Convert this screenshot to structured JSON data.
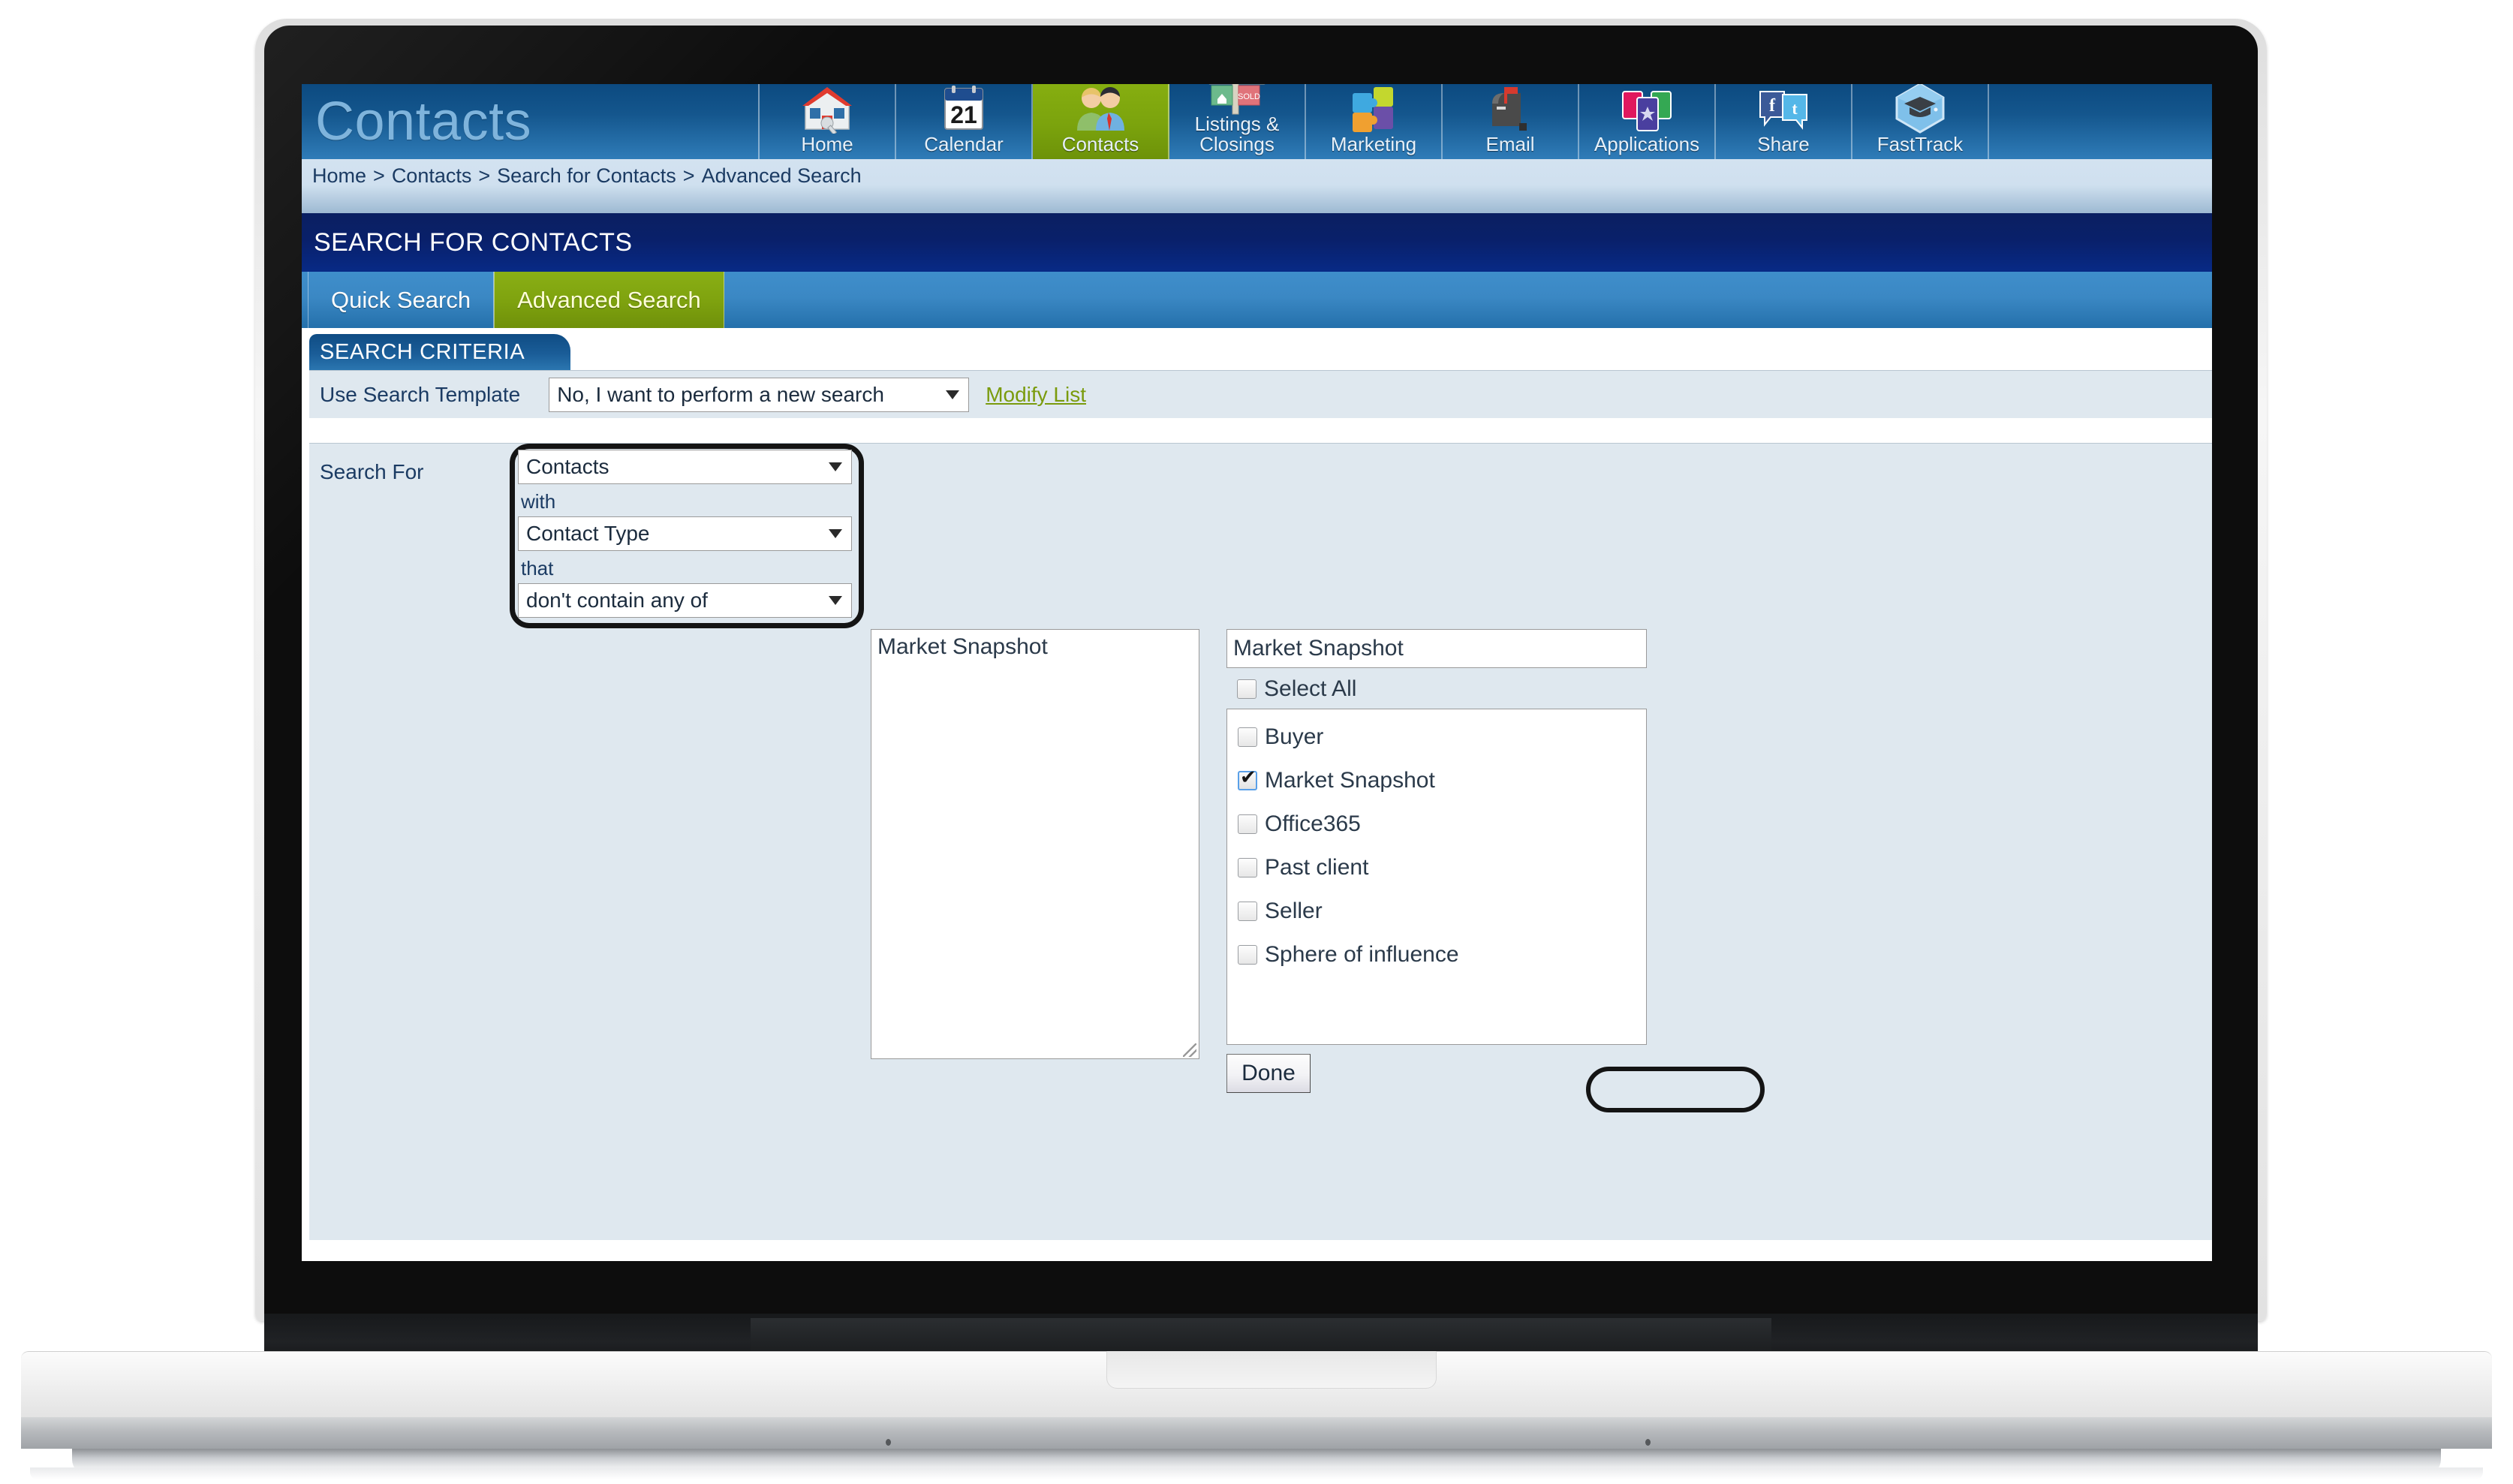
{
  "header": {
    "brand": "Contacts",
    "nav": [
      {
        "label": "Home",
        "icon": "house-icon",
        "active": false
      },
      {
        "label": "Calendar",
        "icon": "calendar-icon",
        "active": false
      },
      {
        "label": "Contacts",
        "icon": "people-icon",
        "active": true
      },
      {
        "label": "Listings &\nClosings",
        "icon": "sold-sign-icon",
        "active": false
      },
      {
        "label": "Marketing",
        "icon": "puzzle-icon",
        "active": false
      },
      {
        "label": "Email",
        "icon": "mailbox-icon",
        "active": false
      },
      {
        "label": "Applications",
        "icon": "apps-icon",
        "active": false
      },
      {
        "label": "Share",
        "icon": "social-icon",
        "active": false
      },
      {
        "label": "FastTrack",
        "icon": "graduation-hex-icon",
        "active": false
      }
    ]
  },
  "breadcrumb": {
    "items": [
      "Home",
      "Contacts",
      "Search for Contacts",
      "Advanced Search"
    ],
    "separator": ">"
  },
  "page_title": "SEARCH FOR CONTACTS",
  "tabs": [
    {
      "label": "Quick Search",
      "active": false
    },
    {
      "label": "Advanced Search",
      "active": true
    }
  ],
  "criteria": {
    "panel_title": "SEARCH CRITERIA",
    "template_label": "Use Search Template",
    "template_value": "No, I want to perform a new search",
    "modify_link": "Modify List",
    "search_for_label": "Search For",
    "entity_value": "Contacts",
    "with_word": "with",
    "field_value": "Contact Type",
    "that_word": "that",
    "operator_value": "don't contain any of",
    "selected_text": "Market Snapshot"
  },
  "picker": {
    "input_value": "Market Snapshot",
    "select_all_label": "Select All",
    "select_all_checked": false,
    "options": [
      {
        "label": "Buyer",
        "checked": false
      },
      {
        "label": "Market Snapshot",
        "checked": true
      },
      {
        "label": "Office365",
        "checked": false
      },
      {
        "label": "Past client",
        "checked": false
      },
      {
        "label": "Seller",
        "checked": false
      },
      {
        "label": "Sphere of influence",
        "checked": false
      }
    ],
    "done_label": "Done"
  },
  "colors": {
    "header_blue": "#14568d",
    "accent_green": "#7ba30d",
    "title_navy": "#09206a",
    "tab_blue": "#3b88c4",
    "panel_bg": "#dfe8ef",
    "link_green": "#7a9b0d",
    "annotation": "#141414"
  }
}
